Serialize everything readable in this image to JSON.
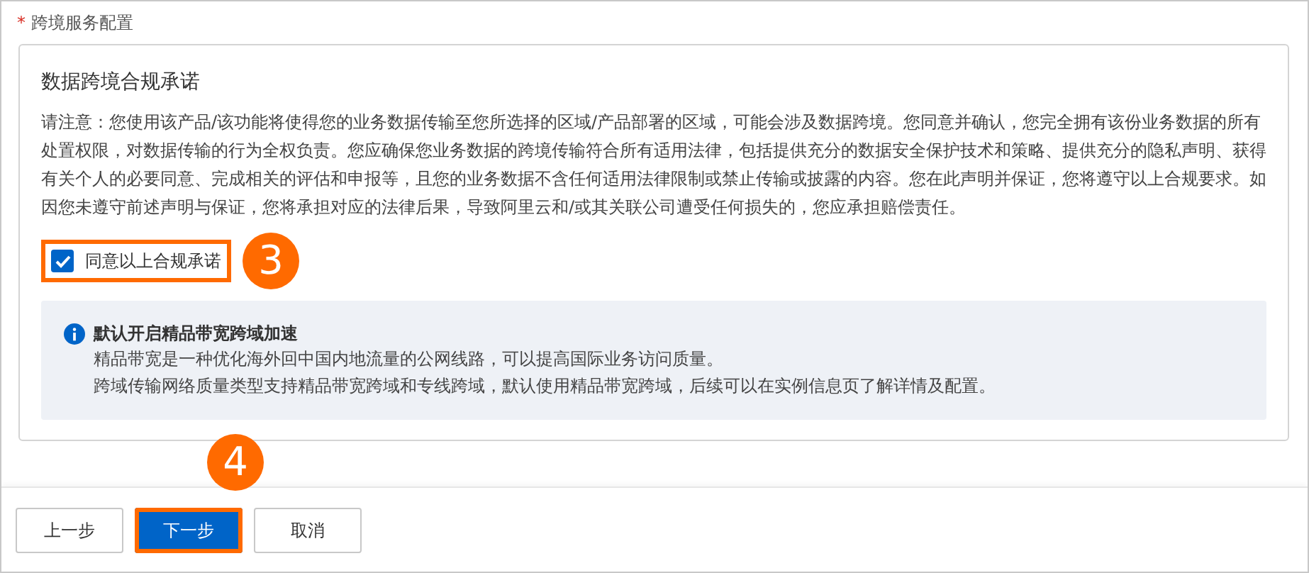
{
  "section_label": {
    "required_mark": "*",
    "text": "跨境服务配置"
  },
  "commitment": {
    "title": "数据跨境合规承诺",
    "body": "请注意：您使用该产品/该功能将使得您的业务数据传输至您所选择的区域/产品部署的区域，可能会涉及数据跨境。您同意并确认，您完全拥有该份业务数据的所有处置权限，对数据传输的行为全权负责。您应确保您业务数据的跨境传输符合所有适用法律，包括提供充分的数据安全保护技术和策略、提供充分的隐私声明、获得有关个人的必要同意、完成相关的评估和申报等，且您的业务数据不含任何适用法律限制或禁止传输或披露的内容。您在此声明并保证，您将遵守以上合规要求。如因您未遵守前述声明与保证，您将承担对应的法律后果，导致阿里云和/或其关联公司遭受任何损失的，您应承担赔偿责任。",
    "agree": {
      "label": "同意以上合规承诺",
      "checked": true,
      "highlighted": true,
      "step_badge": "3"
    }
  },
  "notice": {
    "title": "默认开启精品带宽跨域加速",
    "lines": [
      "精品带宽是一种优化海外回中国内地流量的公网线路，可以提高国际业务访问质量。",
      "跨域传输网络质量类型支持精品带宽跨域和专线跨域，默认使用精品带宽跨域，后续可以在实例信息页了解详情及配置。"
    ]
  },
  "buttons": [
    {
      "label": "上一步",
      "kind": "default",
      "highlighted": false
    },
    {
      "label": "下一步",
      "kind": "primary",
      "highlighted": true,
      "step_badge": "4"
    },
    {
      "label": "取消",
      "kind": "default",
      "highlighted": false
    }
  ]
}
